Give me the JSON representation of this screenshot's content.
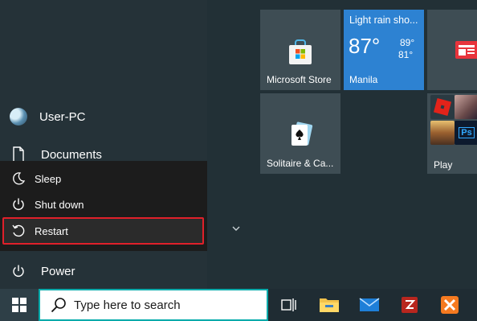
{
  "start_menu": {
    "user_label": "User-PC",
    "documents_label": "Documents",
    "power_label": "Power",
    "power_menu": {
      "sleep_label": "Sleep",
      "shutdown_label": "Shut down",
      "restart_label": "Restart"
    }
  },
  "tiles": {
    "store": {
      "label": "Microsoft Store"
    },
    "weather": {
      "condition": "Light rain sho...",
      "temp": "87°",
      "high": "89°",
      "low": "81°",
      "city": "Manila"
    },
    "solitaire": {
      "label": "Solitaire & Ca..."
    },
    "play": {
      "label": "Play",
      "ps_text": "Ps"
    }
  },
  "taskbar": {
    "search_placeholder": "Type here to search"
  },
  "colors": {
    "highlight_border": "#e0202a",
    "weather_tile": "#2d82d2",
    "search_border": "#00aaaa"
  }
}
